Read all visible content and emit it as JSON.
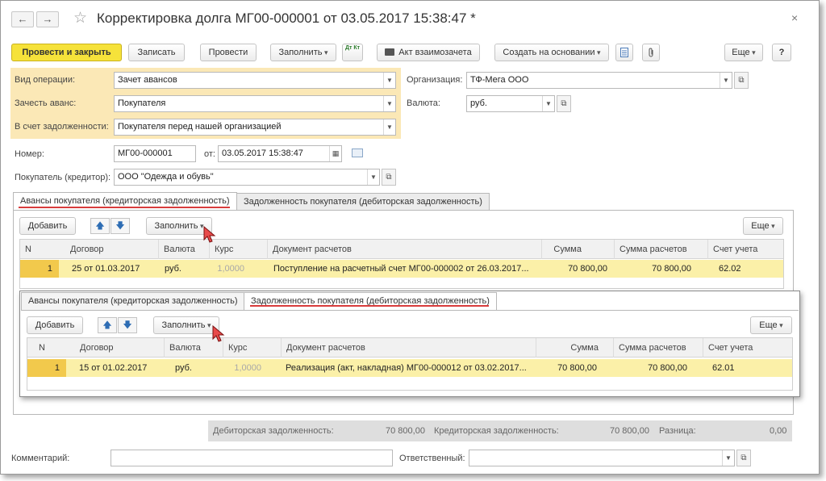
{
  "window": {
    "title": "Корректировка долга МГ00-000001 от 03.05.2017 15:38:47 *",
    "back_icon": "←",
    "forward_icon": "→",
    "star_icon": "☆",
    "close_icon": "×"
  },
  "toolbar": {
    "post_close": "Провести и закрыть",
    "save": "Записать",
    "post": "Провести",
    "fill": "Заполнить",
    "dtkt_icon": "Дт Кт",
    "act": "Акт взаимозачета",
    "create_based": "Создать на основании",
    "more": "Еще",
    "help": "?"
  },
  "form": {
    "operation_label": "Вид операции:",
    "operation_value": "Зачет авансов",
    "offset_label": "Зачесть аванс:",
    "offset_value": "Покупателя",
    "debt_label": "В счет задолженности:",
    "debt_value": "Покупателя перед нашей организацией",
    "org_label": "Организация:",
    "org_value": "ТФ-Мега ООО",
    "currency_label": "Валюта:",
    "currency_value": "руб.",
    "number_label": "Номер:",
    "number_value": "МГ00-000001",
    "date_label": "от:",
    "date_value": "03.05.2017 15:38:47",
    "buyer_label": "Покупатель (кредитор):",
    "buyer_value": "ООО \"Одежда и обувь\""
  },
  "tabs": [
    {
      "label": "Авансы покупателя (кредиторская задолженность)"
    },
    {
      "label": "Задолженность покупателя (дебиторская задолженность)"
    }
  ],
  "table_toolbar": {
    "add": "Добавить",
    "up": "🡅",
    "down": "🡇",
    "fill": "Заполнить",
    "more": "Еще"
  },
  "columns": [
    "N",
    "Договор",
    "Валюта",
    "Курс",
    "Документ расчетов",
    "Сумма",
    "Сумма расчетов",
    "Счет учета"
  ],
  "advances_table": {
    "rows": [
      {
        "n": "1",
        "contract": "25 от 01.03.2017",
        "currency": "руб.",
        "rate": "1,0000",
        "doc": "Поступление на расчетный счет МГ00-000002 от 26.03.2017...",
        "sum": "70 800,00",
        "sum_calc": "70 800,00",
        "account": "62.02"
      }
    ]
  },
  "debts_table": {
    "rows": [
      {
        "n": "1",
        "contract": "15 от 01.02.2017",
        "currency": "руб.",
        "rate": "1,0000",
        "doc": "Реализация (акт, накладная) МГ00-000012 от 03.02.2017...",
        "sum": "70 800,00",
        "sum_calc": "70 800,00",
        "account": "62.01"
      }
    ]
  },
  "totals": {
    "debit_label": "Дебиторская задолженность:",
    "debit_value": "70 800,00",
    "credit_label": "Кредиторская задолженность:",
    "credit_value": "70 800,00",
    "diff_label": "Разница:",
    "diff_value": "0,00"
  },
  "footer": {
    "comment_label": "Комментарий:",
    "comment_value": "",
    "responsible_label": "Ответственный:",
    "responsible_value": ""
  },
  "colors": {
    "primary_button": "#f6e23a",
    "highlight_zone": "#fbe8b6",
    "selected_row": "#fbf0a8",
    "tab_underline": "#d83c3c"
  }
}
